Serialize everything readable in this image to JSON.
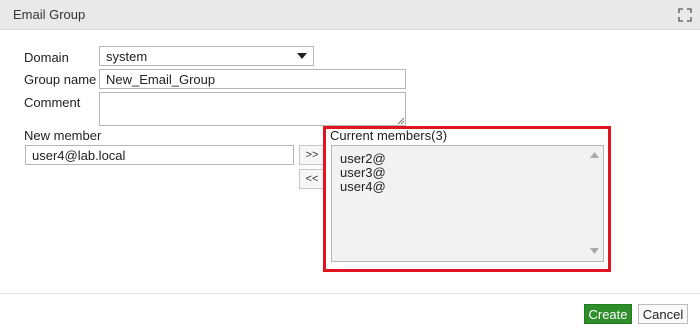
{
  "dialog": {
    "title": "Email Group",
    "maximize_icon": "maximize-icon"
  },
  "form": {
    "domain_label": "Domain",
    "domain_value": "system",
    "group_name_label": "Group name",
    "group_name_value": "New_Email_Group",
    "comment_label": "Comment",
    "comment_value": "",
    "new_member_label": "New member",
    "new_member_value": "user4@lab.local"
  },
  "transfer": {
    "add_label": ">>",
    "remove_label": "<<"
  },
  "members": {
    "label": "Current members(3)",
    "items": [
      "user2@",
      "user3@",
      "user4@"
    ]
  },
  "footer": {
    "create_label": "Create",
    "cancel_label": "Cancel"
  },
  "colors": {
    "accent_create": "#2e8f2a",
    "highlight": "#e0151f"
  }
}
